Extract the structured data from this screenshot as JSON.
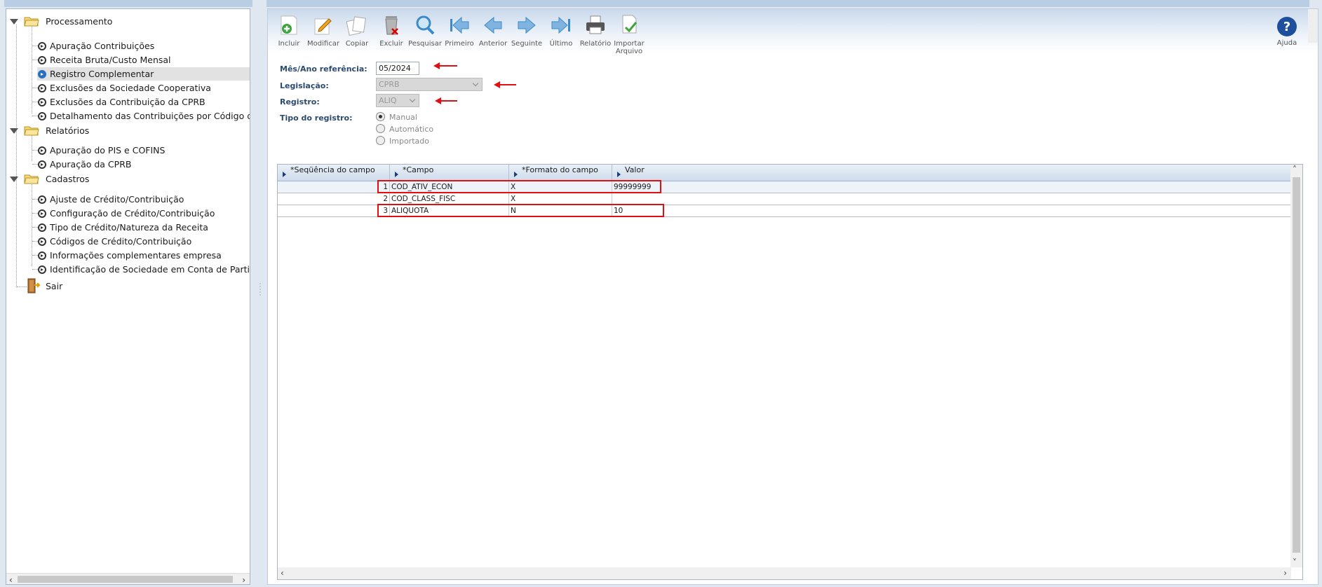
{
  "tree": {
    "groups": [
      {
        "label": "Processamento",
        "items": [
          "Apuração Contribuições",
          "Receita Bruta/Custo Mensal",
          "Registro Complementar",
          "Exclusões da Sociedade Cooperativa",
          "Exclusões da Contribuição da CPRB",
          "Detalhamento das Contribuições por Código da Recei"
        ]
      },
      {
        "label": "Relatórios",
        "items": [
          "Apuração do PIS e COFINS",
          "Apuração da CPRB"
        ]
      },
      {
        "label": "Cadastros",
        "items": [
          "Ajuste de Crédito/Contribuição",
          "Configuração de Crédito/Contribuição",
          "Tipo de Crédito/Natureza da Receita",
          "Códigos de Crédito/Contribuição",
          "Informações complementares empresa",
          "Identificação de Sociedade em Conta de Participação"
        ]
      }
    ],
    "selected_item": "Registro Complementar",
    "exit_label": "Sair"
  },
  "toolbar": {
    "buttons": [
      "Incluir",
      "Modificar",
      "Copiar",
      "Excluir",
      "Pesquisar",
      "Primeiro",
      "Anterior",
      "Seguinte",
      "Último",
      "Relatório",
      "Importar Arquivo"
    ],
    "help_label": "Ajuda"
  },
  "form": {
    "mes_ano_label": "Mês/Ano referência:",
    "mes_ano_value": "05/2024",
    "legislacao_label": "Legislação:",
    "legislacao_value": "CPRB",
    "registro_label": "Registro:",
    "registro_value": "ALIQ",
    "tipo_label": "Tipo do registro:",
    "tipo_options": [
      "Manual",
      "Automático",
      "Importado"
    ],
    "tipo_selected": "Manual"
  },
  "grid": {
    "columns": [
      "*Seqüência do campo",
      "*Campo",
      "*Formato do campo",
      "Valor"
    ],
    "rows": [
      {
        "seq": "1",
        "campo": "COD_ATIV_ECON",
        "formato": "X",
        "valor": "99999999"
      },
      {
        "seq": "2",
        "campo": "COD_CLASS_FISC",
        "formato": "X",
        "valor": ""
      },
      {
        "seq": "3",
        "campo": "ALIQUOTA",
        "formato": "N",
        "valor": "10"
      }
    ]
  },
  "colors": {
    "annotation_red": "#e01010",
    "selection_gray": "#e2e2e2",
    "label_blue": "#2c4b6e"
  }
}
